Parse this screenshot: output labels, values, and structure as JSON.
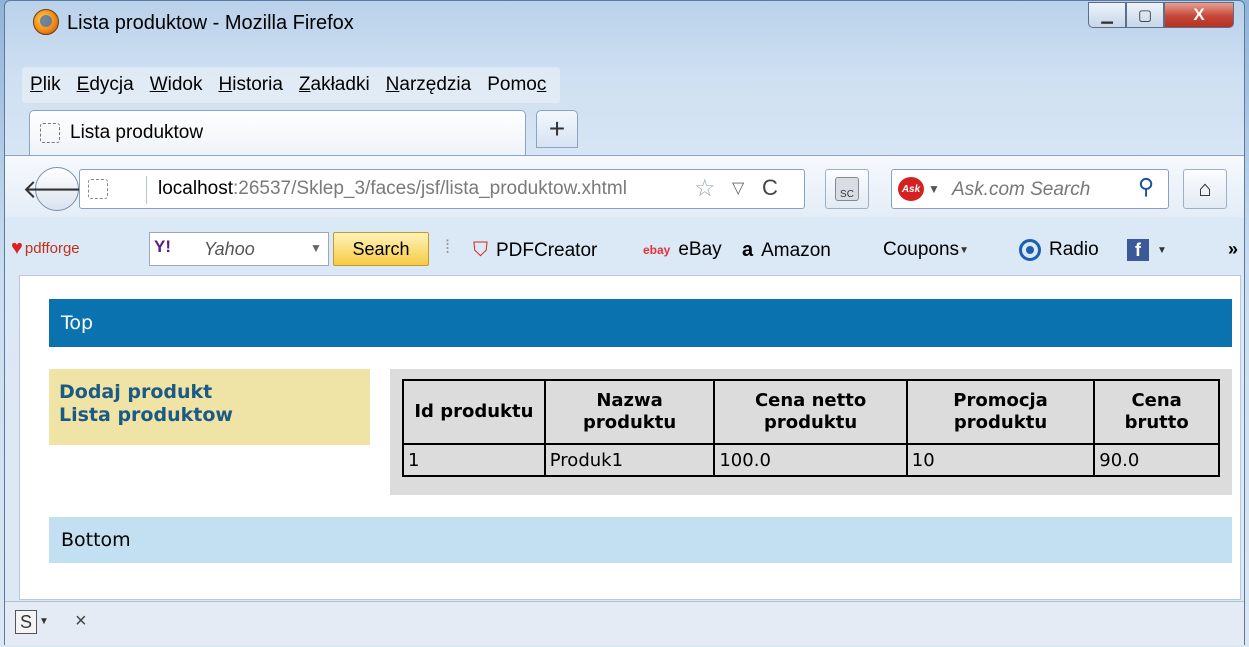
{
  "window": {
    "title": "Lista produktow - Mozilla Firefox",
    "min_glyph": "▁",
    "max_glyph": "▢",
    "close_glyph": "X"
  },
  "menu": [
    {
      "mnemonic": "P",
      "rest": "lik"
    },
    {
      "mnemonic": "E",
      "rest": "dycja"
    },
    {
      "mnemonic": "W",
      "rest": "idok"
    },
    {
      "mnemonic": "H",
      "rest": "istoria"
    },
    {
      "mnemonic": "Z",
      "rest": "akładki"
    },
    {
      "mnemonic": "N",
      "rest": "arzędzia"
    },
    {
      "pre": "Pomo",
      "mnemonic": "c",
      "rest": ""
    }
  ],
  "tab": {
    "label": "Lista produktow",
    "new_tab_glyph": "+"
  },
  "navbar": {
    "back_glyph": "🡐",
    "url_host": "localhost",
    "url_rest": ":26537/Sklep_3/faces/jsf/lista_produktow.xhtml",
    "star_glyph": "☆",
    "drop_glyph": "▽",
    "reload_glyph": "C",
    "search_placeholder": "Ask.com Search",
    "ask_logo": "Ask",
    "search_glyph": "⚲",
    "home_glyph": "⌂",
    "sc_label": "SC"
  },
  "bookmarks": {
    "pdfforge": "pdfforge",
    "yahoo_logo": "Y!",
    "yahoo_text": "Yahoo",
    "search_button": "Search",
    "items": [
      {
        "label": "PDFCreator"
      },
      {
        "label": "eBay"
      },
      {
        "label": "Amazon"
      },
      {
        "label": "Coupons"
      },
      {
        "label": "Radio"
      }
    ],
    "overflow": "»"
  },
  "page": {
    "top": "Top",
    "links": [
      "Dodaj produkt",
      "Lista produktow"
    ],
    "table": {
      "headers": [
        "Id produktu",
        "Nazwa produktu",
        "Cena netto produktu",
        "Promocja produktu",
        "Cena brutto"
      ],
      "rows": [
        [
          "1",
          "Produk1",
          "100.0",
          "10",
          "90.0"
        ]
      ]
    },
    "bottom": "Bottom"
  },
  "statusbar": {
    "s_glyph": "S",
    "close_glyph": "×"
  },
  "colors": {
    "top_bar": "#0b72b0",
    "bottom_bar": "#c2e0f2",
    "menu_bg": "#efe3a6",
    "link": "#1a5a84",
    "table_bg": "#dcdcdc"
  }
}
